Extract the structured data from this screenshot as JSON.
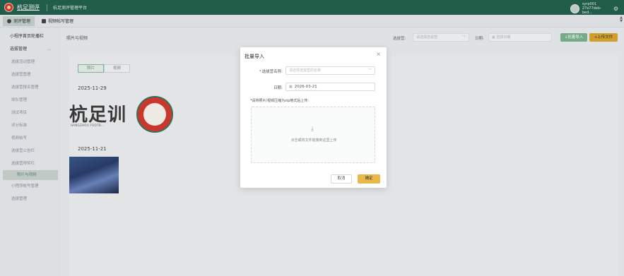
{
  "header": {
    "brand": "杭足测评",
    "platform": "杭足测评管理平台",
    "user_name": "syrp001",
    "user_id": "27e77deb-bed..."
  },
  "tabs": [
    {
      "label": "测评管理",
      "active": true
    },
    {
      "label": "视频帖写管理",
      "active": false
    }
  ],
  "sidebar": {
    "top_item": "小程序首页轮播栏",
    "group": "选拔管理",
    "items": [
      {
        "label": "选拔活动管理",
        "active": false
      },
      {
        "label": "选拔营管理",
        "active": false
      },
      {
        "label": "选拔营报名管理",
        "active": false
      },
      {
        "label": "球队管理",
        "active": false
      },
      {
        "label": "测试项目",
        "active": false
      },
      {
        "label": "评分标准",
        "active": false
      },
      {
        "label": "视频帖写",
        "active": false
      },
      {
        "label": "选拔营公告栏",
        "active": false
      },
      {
        "label": "选拔营得奖栏",
        "active": false
      },
      {
        "label": "照片与视频",
        "active": true
      },
      {
        "label": "小程序帐号管理",
        "active": false
      },
      {
        "label": "选拔管理",
        "active": false
      }
    ]
  },
  "filters": {
    "section_title": "照片与视频",
    "camp_label": "选拔营:",
    "camp_placeholder": "请选择选拔营",
    "date_label": "日期:",
    "date_placeholder": "选择日期",
    "import_button": "↓批量导入",
    "upload_button": "+上传文件"
  },
  "media_tabs": [
    {
      "label": "照片",
      "active": true
    },
    {
      "label": "视频",
      "active": false
    }
  ],
  "groups": [
    {
      "date": "2025-11-29",
      "logo_text": "杭足训",
      "logo_sub": "HANGZHOU FOOTB..."
    },
    {
      "date": "2025-11-21"
    }
  ],
  "modal": {
    "title": "批量导入",
    "close": "×",
    "camp_label": "选拔营名称:",
    "camp_placeholder": "请选择选拔营的名称",
    "date_label": "日期:",
    "date_value": "2026-03-21",
    "upload_hint": "*请将照片/视频压缩为zip格式后上传:",
    "drop_text": "点击或将文件拖拽到这里上传",
    "cancel": "取消",
    "confirm": "确定"
  },
  "colors": {
    "header_bg": "#23614d",
    "accent_green": "#79b28c",
    "accent_gold": "#d9a62b",
    "confirm_bg": "#e8b94a"
  }
}
